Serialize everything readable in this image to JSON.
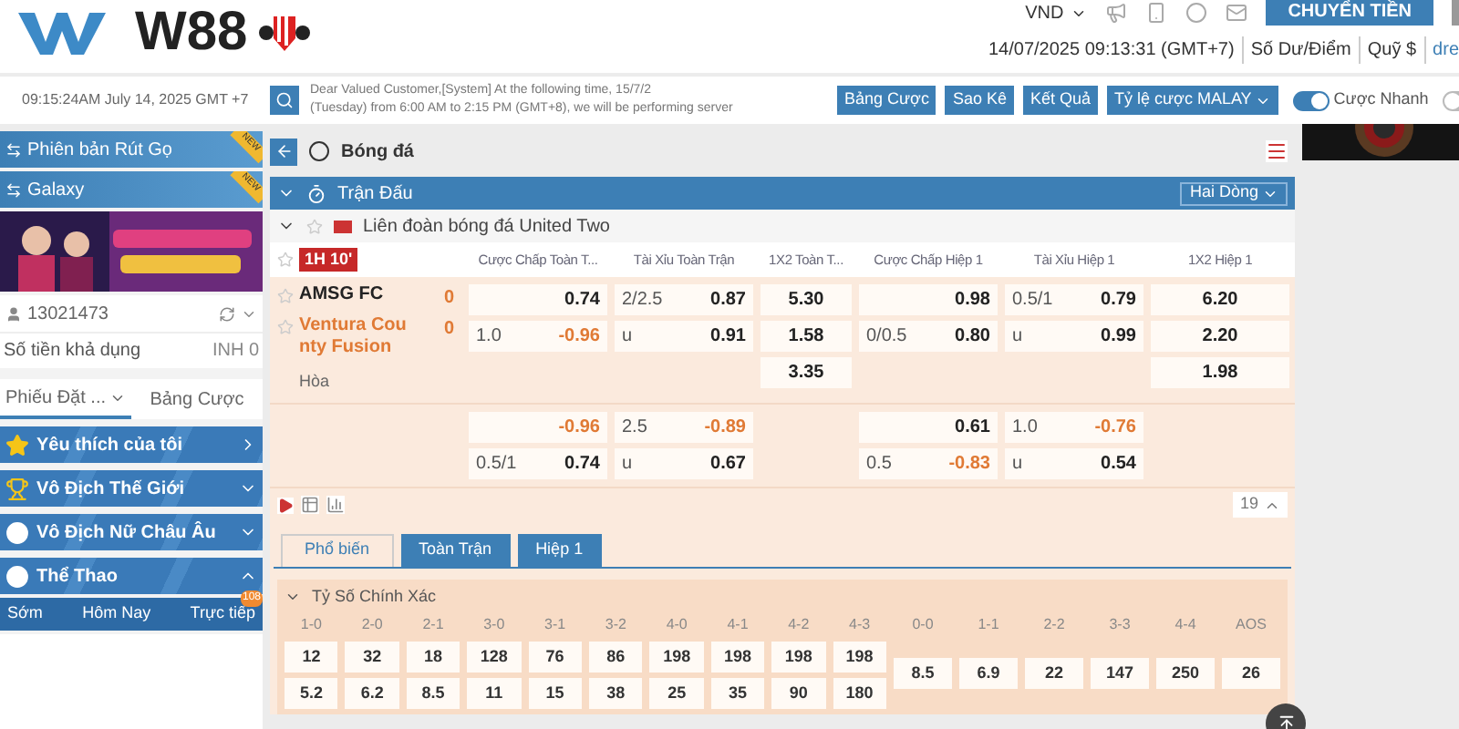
{
  "header": {
    "logo": "W88",
    "currency": "VND",
    "transfer_button": "CHUYỂN TIỀN",
    "info": [
      "14/07/2025 09:13:31 (GMT+7)",
      "Số Dư/Điểm",
      "Quỹ $",
      "dre"
    ]
  },
  "toolbar": {
    "clock": "09:15:24AM July 14, 2025 GMT +7",
    "notice": [
      "Dear Valued Customer,[System] At the following time, 15/7/2",
      "(Tuesday) from 6:00 AM to 2:15 PM (GMT+8), we will be performing server"
    ],
    "buttons": [
      "Bảng Cược",
      "Sao Kê",
      "Kết Quả"
    ],
    "odds_dropdown": "Tỷ lệ cược MALAY",
    "toggles": [
      {
        "label": "Cược Nhanh",
        "on": true
      },
      {
        "on": false
      }
    ]
  },
  "sidebar": {
    "promos": [
      {
        "label": "Phiên bản Rút Gọ",
        "badge": "NEW"
      },
      {
        "label": "Galaxy",
        "badge": "NEW"
      }
    ],
    "account": {
      "id": "13021473",
      "balance_label": "Số tiền khả dụng",
      "balance": "INH 0"
    },
    "bet_tabs": [
      {
        "label": "Phiếu Đặt ...",
        "selected": true
      },
      {
        "label": "Bảng Cược",
        "selected": false
      }
    ],
    "categories": [
      {
        "label": "Yêu thích của tôi",
        "kind": "star",
        "link": true,
        "expanded": false
      },
      {
        "label": "Vô Địch Thế Giới",
        "kind": "trophy",
        "link": false,
        "expanded": false
      },
      {
        "label": "Vô Địch Nữ Châu Âu",
        "kind": "ball",
        "link": false,
        "expanded": false
      },
      {
        "label": "Thể Thao",
        "kind": "ball",
        "link": false,
        "expanded": true
      }
    ],
    "sport_tabs": [
      {
        "label": "Sớm"
      },
      {
        "label": "Hôm Nay"
      },
      {
        "label": "Trực tiếp",
        "badge": "108"
      }
    ]
  },
  "main": {
    "breadcrumb": "Bóng đá",
    "section": "Trận Đấu",
    "view_dropdown": "Hai Dòng",
    "league": "Liên đoàn bóng đá United Two",
    "match": {
      "time": "1H 10'",
      "columns": [
        "Cược Chấp Toàn T...",
        "Tài Xỉu Toàn Trận",
        "1X2 Toàn T...",
        "Cược Chấp Hiệp 1",
        "Tài Xỉu Hiệp 1",
        "1X2 Hiệp 1"
      ],
      "teams": [
        {
          "name": "AMSG FC",
          "score": "0",
          "favourite": false
        },
        {
          "name": "Ventura Cou nty Fusion",
          "score": "0",
          "favourite": true
        }
      ],
      "draw": "Hòa",
      "lines": [
        {
          "hdp": [
            {
              "odds": "0.74",
              "negative": false
            },
            {
              "line": "1.0",
              "odds": "-0.96",
              "negative": true
            }
          ],
          "ou": [
            {
              "line": "2/2.5",
              "odds": "0.87",
              "negative": false
            },
            {
              "line": "u",
              "odds": "0.91",
              "negative": false
            }
          ],
          "x12": [
            "5.30",
            "1.58",
            "3.35"
          ],
          "h1_hdp": [
            {
              "odds": "0.98",
              "negative": false
            },
            {
              "line": "0/0.5",
              "odds": "0.80",
              "negative": false
            }
          ],
          "h1_ou": [
            {
              "line": "0.5/1",
              "odds": "0.79",
              "negative": false
            },
            {
              "line": "u",
              "odds": "0.99",
              "negative": false
            }
          ],
          "h1_x12": [
            "6.20",
            "2.20",
            "1.98"
          ]
        },
        {
          "hdp": [
            {
              "odds": "-0.96",
              "negative": true
            },
            {
              "line": "0.5/1",
              "odds": "0.74",
              "negative": false
            }
          ],
          "ou": [
            {
              "line": "2.5",
              "odds": "-0.89",
              "negative": true
            },
            {
              "line": "u",
              "odds": "0.67",
              "negative": false
            }
          ],
          "h1_hdp": [
            {
              "odds": "0.61",
              "negative": false
            },
            {
              "line": "0.5",
              "odds": "-0.83",
              "negative": true
            }
          ],
          "h1_ou": [
            {
              "line": "1.0",
              "odds": "-0.76",
              "negative": true
            },
            {
              "line": "u",
              "odds": "0.54",
              "negative": false
            }
          ]
        }
      ],
      "more_count": "19"
    },
    "market_tabs": [
      {
        "label": "Phổ biến",
        "selected": true
      },
      {
        "label": "Toàn Trận",
        "selected": false
      },
      {
        "label": "Hiệp 1",
        "selected": false
      }
    ],
    "correct_score": {
      "title": "Tỷ Số Chính Xác",
      "home_away": {
        "scores": [
          "1-0",
          "2-0",
          "2-1",
          "3-0",
          "3-1",
          "3-2",
          "4-0",
          "4-1",
          "4-2",
          "4-3"
        ],
        "home": [
          "12",
          "32",
          "18",
          "128",
          "76",
          "86",
          "198",
          "198",
          "198",
          "198"
        ],
        "away": [
          "5.2",
          "6.2",
          "8.5",
          "11",
          "15",
          "38",
          "25",
          "35",
          "90",
          "180"
        ]
      },
      "draw": {
        "scores": [
          "0-0",
          "1-1",
          "2-2",
          "3-3",
          "4-4",
          "AOS"
        ],
        "odds": [
          "8.5",
          "6.9",
          "22",
          "147",
          "250",
          "26"
        ]
      }
    }
  }
}
